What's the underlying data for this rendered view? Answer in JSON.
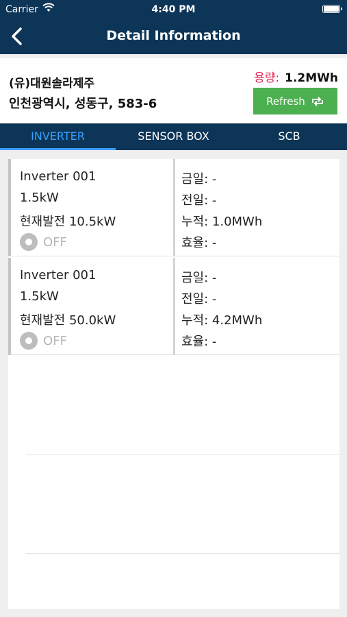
{
  "status_bar": {
    "carrier": "Carrier",
    "time": "4:40 PM"
  },
  "nav": {
    "title": "Detail Information"
  },
  "site": {
    "name": "(유)대원솔라제주",
    "address": "인천광역시, 성동구, 583-6",
    "capacity_label": "용량:",
    "capacity_value": "1.2MWh",
    "refresh_label": "Refresh"
  },
  "tabs": [
    "INVERTER",
    "SENSOR BOX",
    "SCB"
  ],
  "inverters": [
    {
      "name": "Inverter 001",
      "rating": "1.5kW",
      "current": "현재발전 10.5kW",
      "status": "OFF",
      "today": "금일: -",
      "yesterday": "전일: -",
      "cumulative": "누적: 1.0MWh",
      "efficiency": "효율: -"
    },
    {
      "name": "Inverter 001",
      "rating": "1.5kW",
      "current": "현재발전 50.0kW",
      "status": "OFF",
      "today": "금일: -",
      "yesterday": "전일: -",
      "cumulative": "누적: 4.2MWh",
      "efficiency": "효율: -"
    }
  ],
  "colors": {
    "header": "#0d3557",
    "accent": "#3a9fff",
    "refresh": "#4caf50",
    "capacity_label": "#e01e4b"
  }
}
